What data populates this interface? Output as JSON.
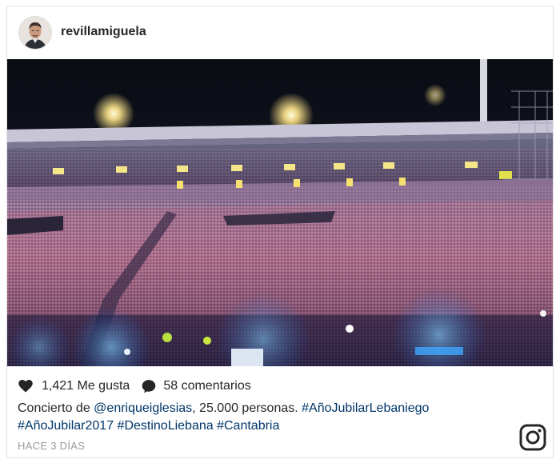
{
  "post": {
    "username": "revillamiguela",
    "likes_count": "1,421",
    "likes_label": "Me gusta",
    "comments_count": "58",
    "comments_label": "comentarios",
    "caption": {
      "text_1": "Concierto de ",
      "mention": "@enriqueiglesias",
      "text_2": ", 25.000 personas. ",
      "tag_1": "#AñoJubilarLebaniego",
      "tag_2": "#AñoJubilar2017",
      "tag_3": "#DestinoLiebana",
      "tag_4": "#Cantabria"
    },
    "timestamp": "HACE 3 DÍAS"
  },
  "icons": {
    "heart": "heart-icon",
    "comment": "comment-icon",
    "brand": "instagram-icon",
    "avatar": "avatar"
  },
  "colors": {
    "text": "#262626",
    "link": "#003569",
    "muted": "#999999",
    "border": "#e2e2e2"
  }
}
